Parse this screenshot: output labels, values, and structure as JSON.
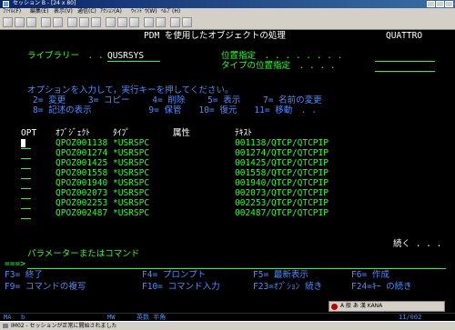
{
  "window": {
    "title": "セッション B - [24 x 80]"
  },
  "menu": [
    "ﾌｧｲﾙ(F)",
    "編集(E)",
    "表示(V)",
    "通信(C)",
    "ｱｸｼｮﾝ(A)",
    "ｳｨﾝﾄﾞｳ(W)",
    "ﾍﾙﾌﾟ(H)"
  ],
  "toolbar": {
    "icons": [
      "print-icon",
      "copy-icon",
      "paste-icon",
      "send-icon",
      "receive-icon",
      "display-icon",
      "color-icon",
      "keyboard-icon",
      "macro-play-icon",
      "macro-record-icon",
      "stop-icon",
      "help-icon",
      "map-icon",
      "settings-icon",
      "quit-icon"
    ]
  },
  "screen": {
    "title": "PDM を使用したオブジェクトの処理",
    "system": "QUATTRO",
    "library_label": "ライブラリー　. .",
    "library_value": "QUSRSYS",
    "position_label": "位置指定　. . . . . . . .",
    "type_position_label": "タイプの位置指定　. . . .",
    "instruction": "オプションを入力して，実行キーを押してください。",
    "options_row1": "2= 変更　　 3= コピー　　 4= 削除　　 5= 表示　　 7= 名前の変更",
    "options_row2": "8= 記述の表示　　　　　　 9= 保管　　10= 復元　　11= 移動　. .",
    "col_opt": "OPT",
    "col_object": "ｵﾌﾞｼﾞｪｸﾄ",
    "col_type": "ﾀｲﾌﾟ",
    "col_attr": "属性",
    "col_text": "ﾃｷｽﾄ",
    "rows": [
      {
        "object": "QPOZ001138",
        "type": "*USRSPC",
        "text": "001138/QTCP/QTCPIP"
      },
      {
        "object": "QPOZ001274",
        "type": "*USRSPC",
        "text": "001274/QTCP/QTCPIP"
      },
      {
        "object": "QPOZ001425",
        "type": "*USRSPC",
        "text": "001425/QTCP/QTCPIP"
      },
      {
        "object": "QPOZ001558",
        "type": "*USRSPC",
        "text": "001558/QTCP/QTCPIP"
      },
      {
        "object": "QPOZ001940",
        "type": "*USRSPC",
        "text": "001940/QTCP/QTCPIP"
      },
      {
        "object": "QPOZ002073",
        "type": "*USRSPC",
        "text": "002073/QTCP/QTCPIP"
      },
      {
        "object": "QPOZ002253",
        "type": "*USRSPC",
        "text": "002253/QTCP/QTCPIP"
      },
      {
        "object": "QPOZ002487",
        "type": "*USRSPC",
        "text": "002487/QTCP/QTCPIP"
      }
    ],
    "more": "続く . . .",
    "param_label": "パラメーターまたはコマンド",
    "prompt": "===>",
    "fkeys_row1": [
      "F3= 終了",
      "F4= プロンプト",
      "F5= 最新表示",
      "F6= 作成"
    ],
    "fkeys_row2": [
      "F9= コマンドの複写",
      "F10= コマンド入力",
      "F23=ｵﾌﾟｼｮﾝ 続き",
      "F24=ｷｰ の続き"
    ]
  },
  "oia": {
    "ma": "MA",
    "b": "b",
    "mw": "MW",
    "mode": "英数 半角",
    "cursor_pos": "11/002"
  },
  "status": {
    "message": "IM02 - セッションが正常に開始されました"
  },
  "ime": {
    "label": "A 般 あ 漢 KANA"
  }
}
